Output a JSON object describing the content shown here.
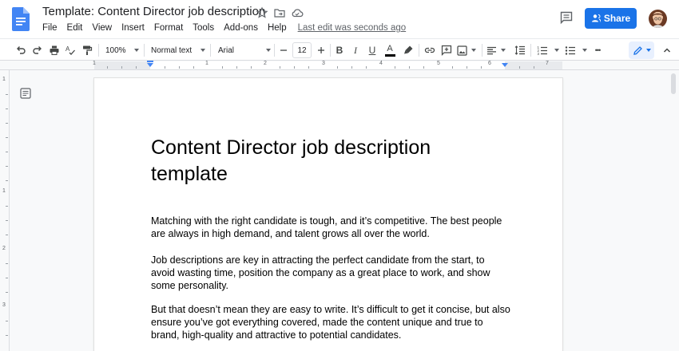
{
  "app": {
    "doc_title": "Template: Content Director job description",
    "last_edit": "Last edit was seconds ago",
    "share_label": "Share"
  },
  "menu": [
    "File",
    "Edit",
    "View",
    "Insert",
    "Format",
    "Tools",
    "Add-ons",
    "Help"
  ],
  "toolbar": {
    "zoom": "100%",
    "style": "Normal text",
    "font": "Arial",
    "font_size": "12",
    "bold": "B",
    "italic": "I",
    "underline": "U",
    "text_color_letter": "A",
    "more": "•••"
  },
  "ruler": {
    "numbers": [
      "1",
      "1",
      "2",
      "3",
      "4",
      "5",
      "6",
      "7"
    ],
    "vnumbers": [
      "1",
      "1",
      "2",
      "3"
    ]
  },
  "document": {
    "heading": "Content Director job description template",
    "paragraphs": [
      "Matching with the right candidate is tough, and it’s competitive. The best people are always in high demand, and talent grows all over the world.",
      "Job descriptions are key in attracting the perfect candidate from the start, to avoid wasting time, position the company as a great place to work, and show some personality.",
      "But that doesn’t mean they are easy to write. It’s difficult to get it concise, but also ensure you’ve got everything covered, made the content unique and true to brand, high-quality and attractive to potential candidates."
    ]
  },
  "colors": {
    "accent": "#1a73e8",
    "doc_logo": "#4285f4",
    "text_color_bar": "#000000"
  },
  "icons": [
    "docs-logo-icon",
    "star-icon",
    "move-to-folder-icon",
    "cloud-saved-icon",
    "comment-history-icon",
    "share-person-icon",
    "undo-icon",
    "redo-icon",
    "print-icon",
    "spellcheck-icon",
    "paint-format-icon",
    "link-icon",
    "add-comment-icon",
    "insert-image-icon",
    "align-icon",
    "line-spacing-icon",
    "numbered-list-icon",
    "bulleted-list-icon",
    "editing-mode-pencil-icon",
    "collapse-icon",
    "document-outline-icon"
  ]
}
